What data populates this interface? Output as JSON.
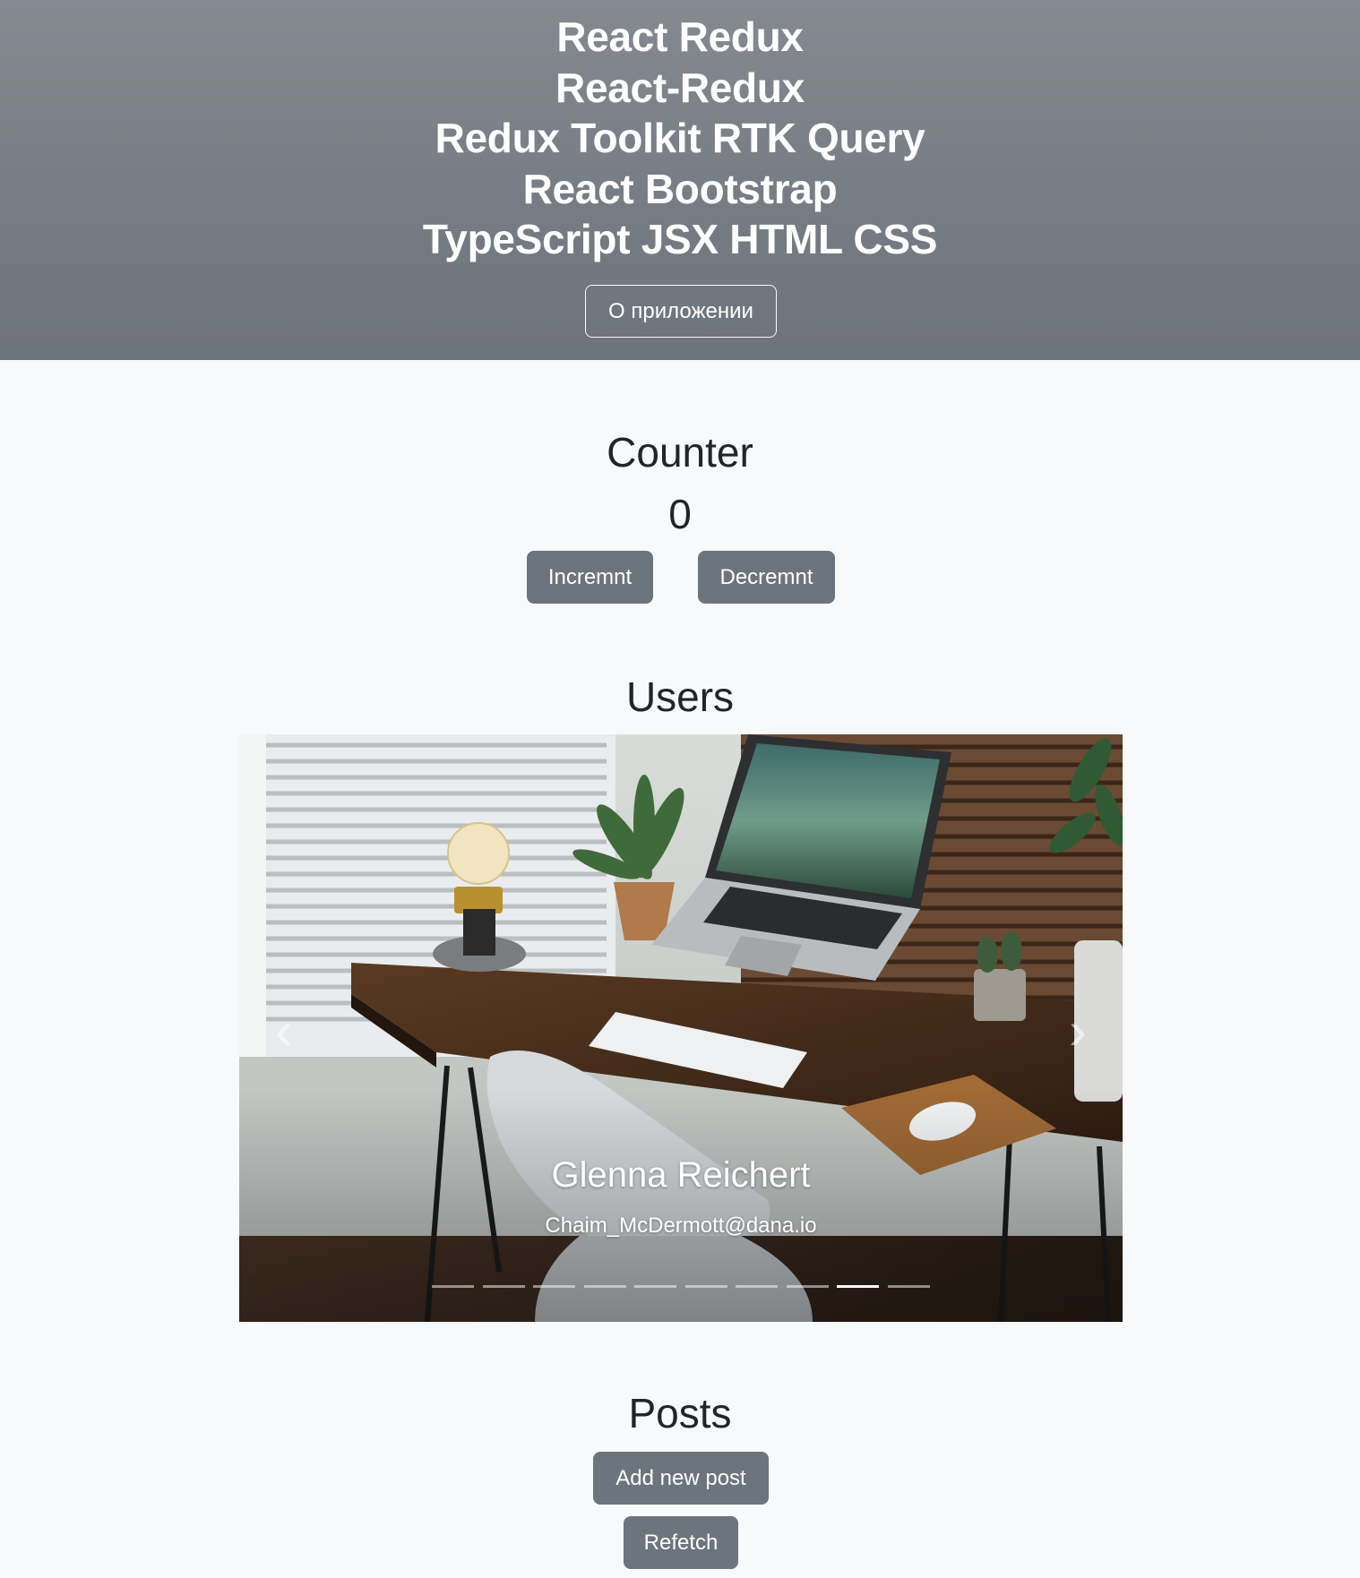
{
  "header": {
    "lines": [
      "React Redux",
      "React-Redux",
      "Redux Toolkit RTK Query",
      "React Bootstrap",
      "TypeScript JSX HTML CSS"
    ],
    "about_button": "О приложении"
  },
  "counter": {
    "title": "Counter",
    "value": "0",
    "increment_label": "Incremnt",
    "decrement_label": "Decremnt"
  },
  "users": {
    "title": "Users",
    "active_user": {
      "name": "Glenna Reichert",
      "email": "Chaim_McDermott@dana.io"
    },
    "slide_count": 10,
    "active_index": 8,
    "prev_icon": "chevron-left-icon",
    "next_icon": "chevron-right-icon"
  },
  "posts": {
    "title": "Posts",
    "add_label": "Add new post",
    "refetch_label": "Refetch"
  },
  "colors": {
    "header_top": "#858990",
    "header_bottom": "#6c737b",
    "button_secondary": "#6c757d",
    "page_background": "#f8f9fa"
  }
}
